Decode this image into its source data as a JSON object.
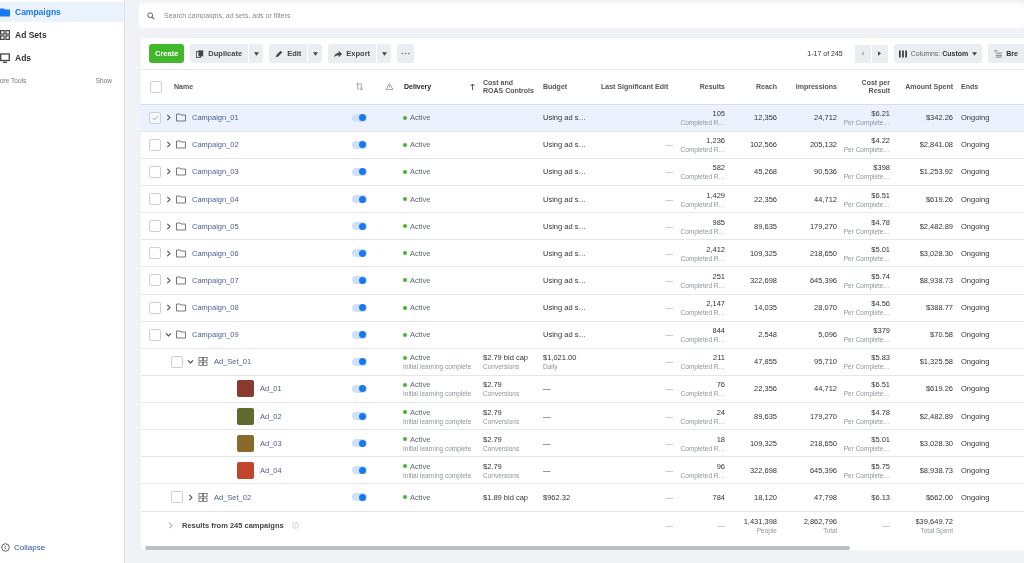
{
  "sidebar": {
    "items": [
      {
        "kind": "campaigns",
        "label": "Campaigns",
        "selected": true
      },
      {
        "kind": "adsets",
        "label": "Ad Sets",
        "selected": false
      },
      {
        "kind": "ads",
        "label": "Ads",
        "selected": false
      }
    ],
    "more_tools": "ore Tools",
    "show": "Show",
    "collapse": "Collapse"
  },
  "search": {
    "placeholder": "Search campaigns, ad sets, ads or filters"
  },
  "toolbar": {
    "create": "Create",
    "buttons": [
      "Duplicate",
      "Edit",
      "Export"
    ],
    "pagination": "1-17 of 245",
    "columns": "Columns: **Custom**",
    "breakdown": "Bre"
  },
  "table": {
    "header_checked": false,
    "columns": [
      "Name",
      "Delivery",
      "Cost and ROAS Controls",
      "Budget",
      "Last Significant Edit",
      "Results",
      "Reach",
      "Impressions",
      "Cost per Result",
      "Amount Spent",
      "Ends"
    ],
    "rows": [
      {
        "kind": "campaign",
        "name": "Campaign_01",
        "checked": true,
        "expanded": false,
        "on": true,
        "delivery": "Active",
        "budget": "Using ad s…",
        "results": "105",
        "results_sub": "Completed R…",
        "reach": "12,356",
        "impressions": "24,712",
        "cpr": "$6.21",
        "cpr_sub": "Per Complete…",
        "spent": "$342.26",
        "ends": "Ongoing"
      },
      {
        "kind": "campaign",
        "name": "Campaign_02",
        "checked": false,
        "expanded": false,
        "on": true,
        "delivery": "Active",
        "budget": "Using ad s…",
        "last_edit": "—",
        "results": "1,236",
        "results_sub": "Completed R…",
        "reach": "102,566",
        "impressions": "205,132",
        "cpr": "$4.22",
        "cpr_sub": "Per Complete…",
        "spent": "$2,841.08",
        "ends": "Ongoing"
      },
      {
        "kind": "campaign",
        "name": "Campaign_03",
        "checked": false,
        "expanded": false,
        "on": true,
        "delivery": "Active",
        "budget": "Using ad s…",
        "last_edit": "—",
        "results": "582",
        "results_sub": "Completed R…",
        "reach": "45,268",
        "impressions": "90,536",
        "cpr": "$398",
        "cpr_sub": "Per Complete…",
        "spent": "$1,253.92",
        "ends": "Ongoing"
      },
      {
        "kind": "campaign",
        "name": "Campaign_04",
        "checked": false,
        "expanded": false,
        "on": true,
        "delivery": "Active",
        "budget": "Using ad s…",
        "last_edit": "—",
        "results": "1,429",
        "results_sub": "Completed R…",
        "reach": "22,356",
        "impressions": "44,712",
        "cpr": "$6.51",
        "cpr_sub": "Per Complete…",
        "spent": "$619.26",
        "ends": "Ongoing"
      },
      {
        "kind": "campaign",
        "name": "Campaign_05",
        "checked": false,
        "expanded": false,
        "on": true,
        "delivery": "Active",
        "budget": "Using ad s…",
        "last_edit": "—",
        "results": "985",
        "results_sub": "Completed R…",
        "reach": "89,635",
        "impressions": "179,270",
        "cpr": "$4.78",
        "cpr_sub": "Per Complete…",
        "spent": "$2,482.89",
        "ends": "Ongoing"
      },
      {
        "kind": "campaign",
        "name": "Campaign_06",
        "checked": false,
        "expanded": false,
        "on": true,
        "delivery": "Active",
        "budget": "Using ad s…",
        "last_edit": "—",
        "results": "2,412",
        "results_sub": "Completed R…",
        "reach": "109,325",
        "impressions": "218,650",
        "cpr": "$5.01",
        "cpr_sub": "Per Complete…",
        "spent": "$3,028.30",
        "ends": "Ongoing"
      },
      {
        "kind": "campaign",
        "name": "Campaign_07",
        "checked": false,
        "expanded": false,
        "on": true,
        "delivery": "Active",
        "budget": "Using ad s…",
        "last_edit": "—",
        "results": "251",
        "results_sub": "Completed R…",
        "reach": "322,698",
        "impressions": "645,396",
        "cpr": "$5.74",
        "cpr_sub": "Per Complete…",
        "spent": "$8,938.73",
        "ends": "Ongoing"
      },
      {
        "kind": "campaign",
        "name": "Campaign_08",
        "checked": false,
        "expanded": false,
        "on": true,
        "delivery": "Active",
        "budget": "Using ad s…",
        "last_edit": "—",
        "results": "2,147",
        "results_sub": "Completed R…",
        "reach": "14,035",
        "impressions": "28,070",
        "cpr": "$4.56",
        "cpr_sub": "Per Complete…",
        "spent": "$388.77",
        "ends": "Ongoing"
      },
      {
        "kind": "campaign",
        "name": "Campaign_09",
        "checked": false,
        "expanded": true,
        "on": true,
        "delivery": "Active",
        "budget": "Using ad s…",
        "last_edit": "—",
        "results": "844",
        "results_sub": "Completed R…",
        "reach": "2,548",
        "impressions": "5,096",
        "cpr": "$379",
        "cpr_sub": "Per Complete…",
        "spent": "$70.58",
        "ends": "Ongoing",
        "children": [
          {
            "kind": "adset",
            "name": "Ad_Set_01",
            "checked": false,
            "expanded": true,
            "on": true,
            "delivery": "Active",
            "delivery_sub": "Initial learning complete",
            "bid": "$2.79 bid cap",
            "bid_sub": "Conversions",
            "budget": "$1,021.00",
            "budget_sub": "Daily",
            "last_edit": "—",
            "results": "211",
            "results_sub": "Completed R…",
            "reach": "47,855",
            "impressions": "95,710",
            "cpr": "$5.83",
            "cpr_sub": "Per Complete…",
            "spent": "$1,325.58",
            "ends": "Ongoing",
            "children": [
              {
                "kind": "ad",
                "name": "Ad_01",
                "on": true,
                "delivery": "Active",
                "delivery_sub": "Initial learning complete",
                "bid": "$2.79",
                "bid_sub": "Conversions",
                "budget": "—",
                "last_edit": "—",
                "results": "76",
                "results_sub": "Completed R…",
                "reach": "22,356",
                "impressions": "44,712",
                "cpr": "$6.51",
                "cpr_sub": "Per Complete…",
                "spent": "$619.26",
                "ends": "Ongoing"
              },
              {
                "kind": "ad",
                "name": "Ad_02",
                "on": true,
                "delivery": "Active",
                "delivery_sub": "Initial learning complete",
                "bid": "$2.79",
                "bid_sub": "Conversions",
                "budget": "—",
                "last_edit": "—",
                "results": "24",
                "results_sub": "Completed R…",
                "reach": "89,635",
                "impressions": "179,270",
                "cpr": "$4.78",
                "cpr_sub": "Per Complete…",
                "spent": "$2,482.89",
                "ends": "Ongoing"
              },
              {
                "kind": "ad",
                "name": "Ad_03",
                "on": true,
                "delivery": "Active",
                "delivery_sub": "Initial learning complete",
                "bid": "$2.79",
                "bid_sub": "Conversions",
                "budget": "—",
                "last_edit": "—",
                "results": "18",
                "results_sub": "Completed R…",
                "reach": "109,325",
                "impressions": "218,650",
                "cpr": "$5.01",
                "cpr_sub": "Per Complete…",
                "spent": "$3,028.30",
                "ends": "Ongoing"
              },
              {
                "kind": "ad",
                "name": "Ad_04",
                "on": true,
                "delivery": "Active",
                "delivery_sub": "Initial learning complete",
                "bid": "$2.79",
                "bid_sub": "Conversions",
                "budget": "—",
                "last_edit": "—",
                "results": "96",
                "results_sub": "Completed R…",
                "reach": "322,698",
                "impressions": "645,396",
                "cpr": "$5.75",
                "cpr_sub": "Per Complete…",
                "spent": "$8,938.73",
                "ends": "Ongoing"
              }
            ]
          },
          {
            "kind": "adset",
            "name": "Ad_Set_02",
            "checked": false,
            "expanded": false,
            "on": true,
            "delivery": "Active",
            "bid": "$1.89 bid cap",
            "budget": "$962.32",
            "last_edit": "—",
            "results": "784",
            "reach": "18,120",
            "impressions": "47,798",
            "cpr": "$6.13",
            "spent": "$662.00",
            "ends": "Ongoing"
          }
        ]
      }
    ],
    "footer": {
      "label": "Results from 245 campaigns",
      "last_edit": "—",
      "results": "—",
      "reach": "1,431,398",
      "reach_sub": "People",
      "impressions": "2,862,796",
      "impressions_sub": "Total",
      "cpr": "—",
      "spent": "$39,649.72",
      "spent_sub": "Total Spent"
    }
  }
}
